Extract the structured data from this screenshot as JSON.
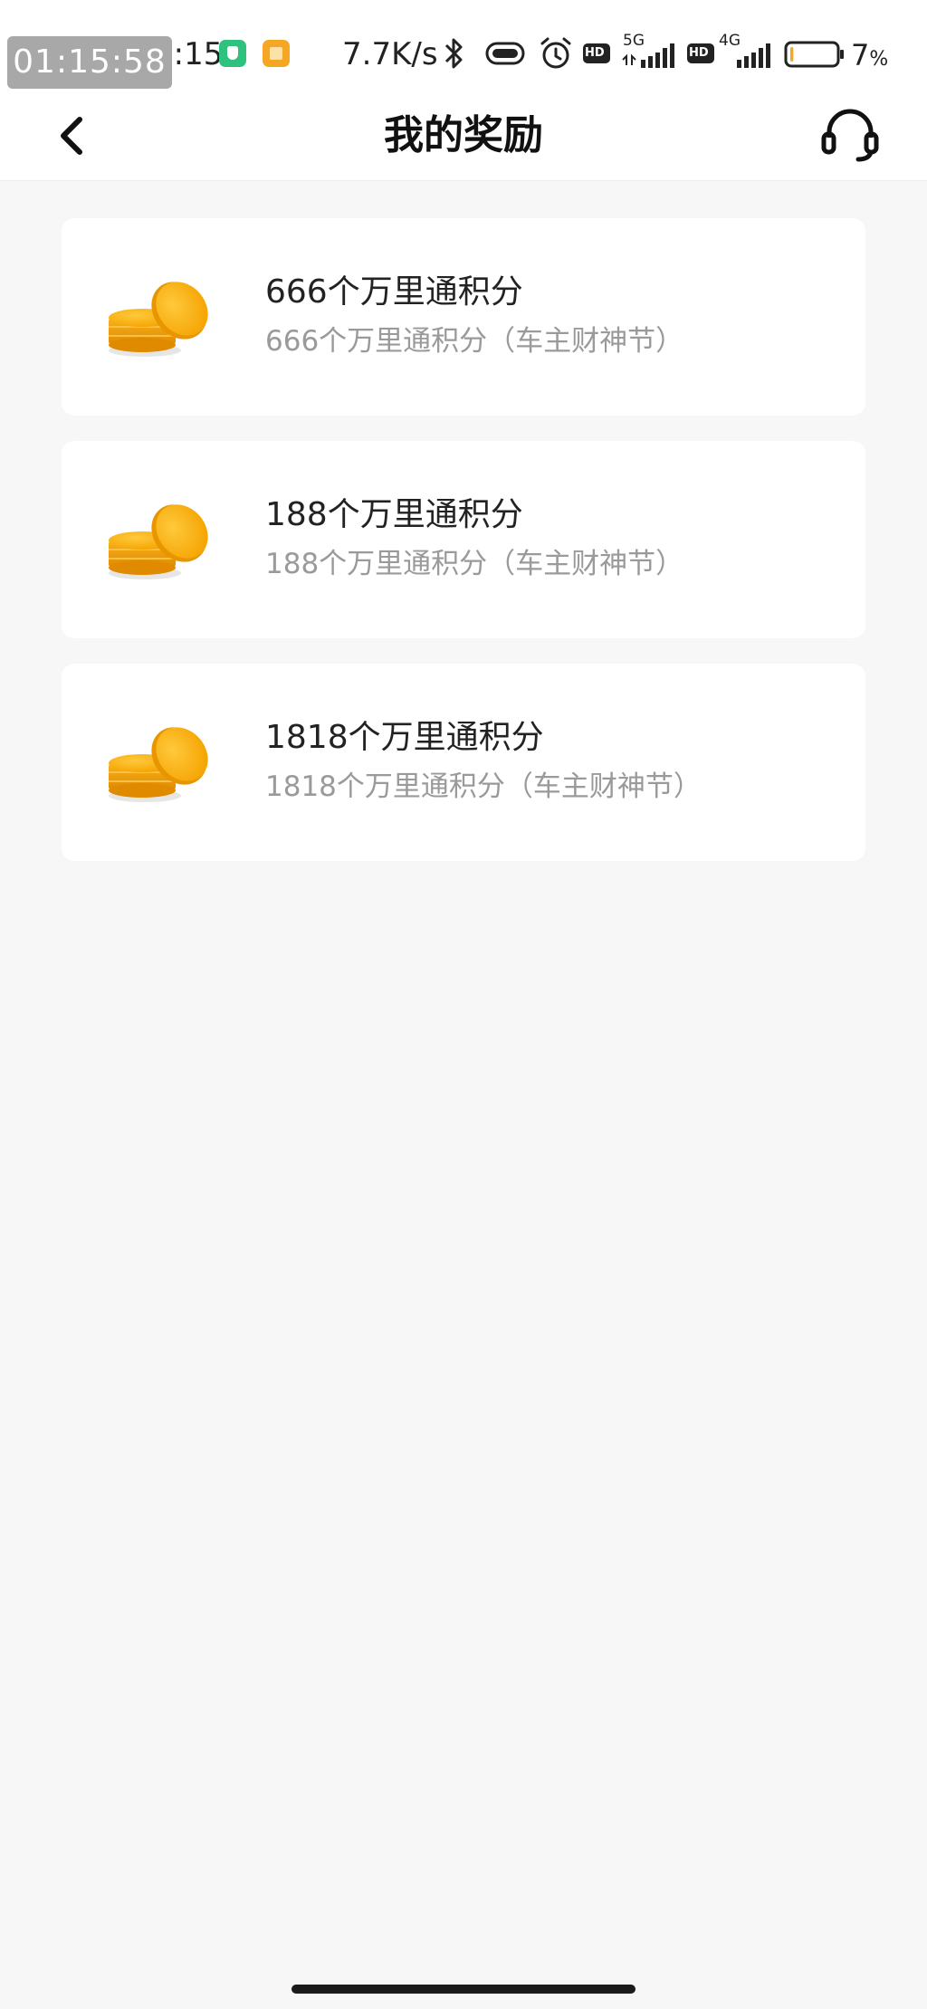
{
  "status_bar": {
    "timer": "01:15:58",
    "time": "1:15",
    "net_speed": "7.7K/s",
    "signal_5g_label": "5G",
    "signal_4g_label": "4G",
    "hd_label": "HD",
    "battery_percent": "7",
    "battery_unit": "%",
    "battery_level": 0.07,
    "icons": [
      "shield-app-icon",
      "note-app-icon",
      "bluetooth-icon",
      "vibrate-icon",
      "alarm-icon",
      "hd-icon",
      "signal-5g-icon",
      "hd-icon",
      "signal-4g-icon",
      "battery-icon"
    ]
  },
  "nav": {
    "title": "我的奖励",
    "back_icon": "chevron-left-icon",
    "support_icon": "headset-icon"
  },
  "rewards": [
    {
      "title": "666个万里通积分",
      "subtitle": "666个万里通积分（车主财神节）",
      "icon": "coin-stack-icon"
    },
    {
      "title": "188个万里通积分",
      "subtitle": "188个万里通积分（车主财神节）",
      "icon": "coin-stack-icon"
    },
    {
      "title": "1818个万里通积分",
      "subtitle": "1818个万里通积分（车主财神节）",
      "icon": "coin-stack-icon"
    }
  ],
  "colors": {
    "background": "#f7f7f7",
    "card": "#ffffff",
    "coin": "#f5a300",
    "subtitle": "#9a9a9a"
  }
}
